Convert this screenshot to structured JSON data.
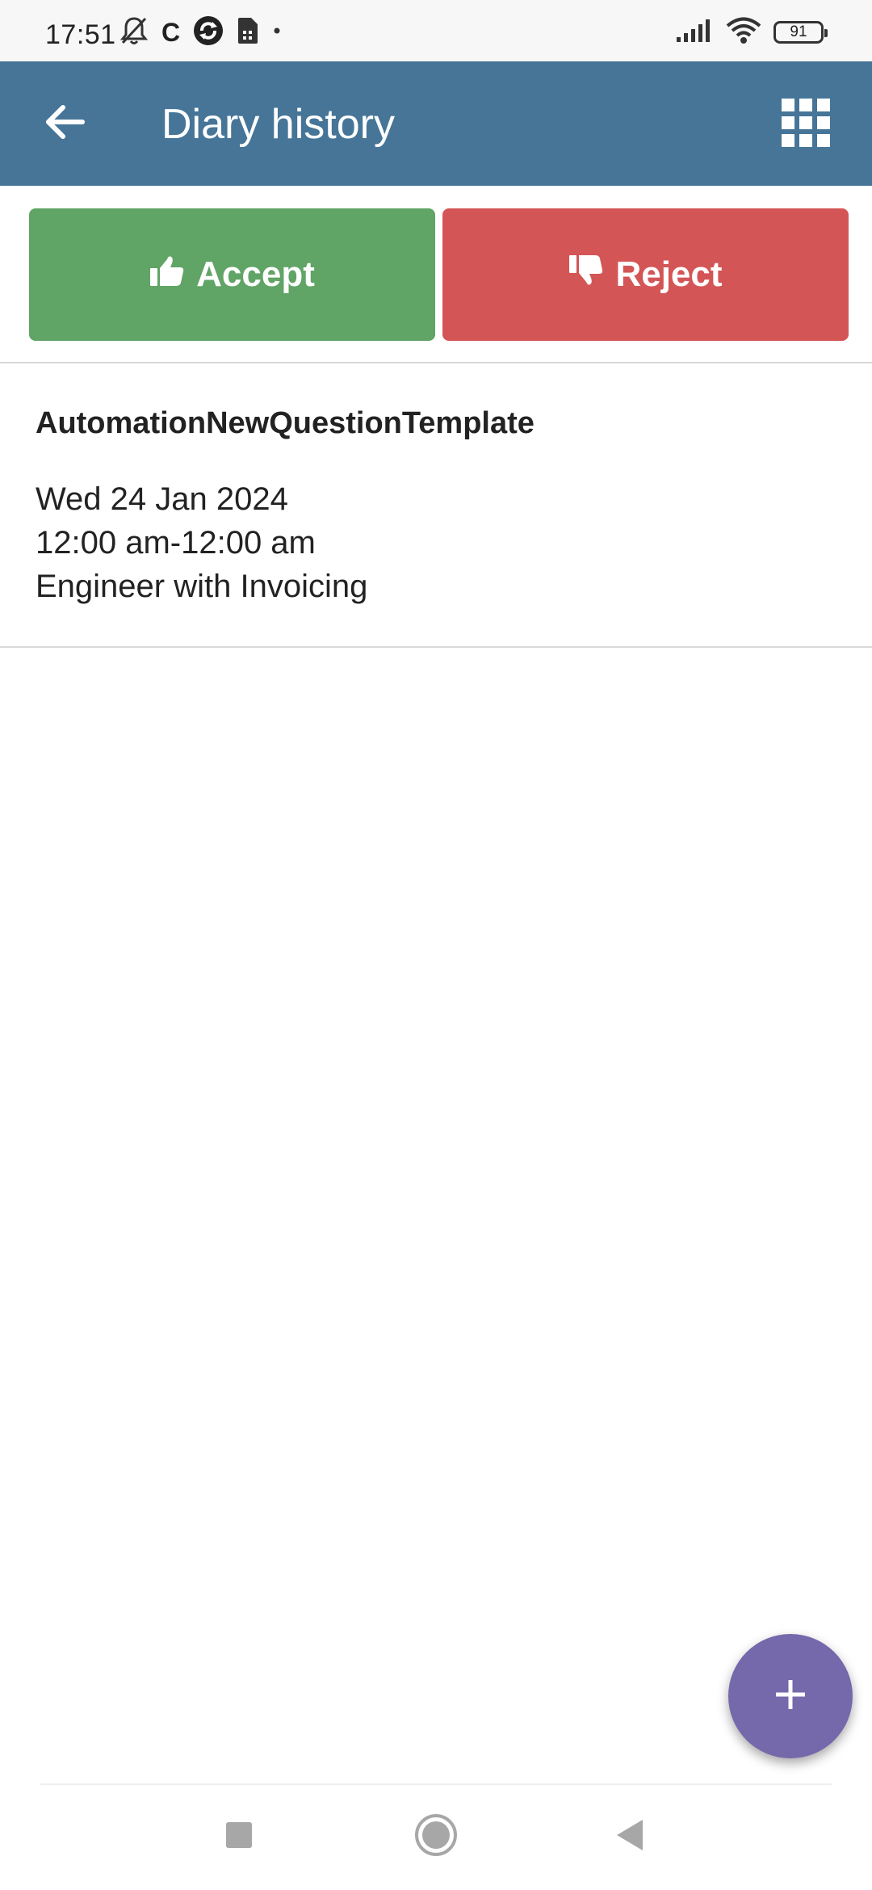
{
  "status_bar": {
    "time": "17:51",
    "carrier_letter": "C",
    "battery": "91"
  },
  "app_bar": {
    "title": "Diary history"
  },
  "actions": {
    "accept_label": "Accept",
    "reject_label": "Reject",
    "accept_color": "#60a466",
    "reject_color": "#d45556"
  },
  "entries": [
    {
      "title": "AutomationNewQuestionTemplate",
      "date": "Wed 24 Jan 2024",
      "time_range": "12:00 am-12:00 am",
      "role": "Engineer with Invoicing"
    }
  ],
  "theme": {
    "app_bar_color": "#467598",
    "fab_color": "#7568ab"
  },
  "icons": {
    "back": "arrow-left-icon",
    "menu": "grid-icon",
    "fab": "plus-icon",
    "nav_recent": "square-icon",
    "nav_home": "circle-icon",
    "nav_back": "triangle-back-icon"
  }
}
